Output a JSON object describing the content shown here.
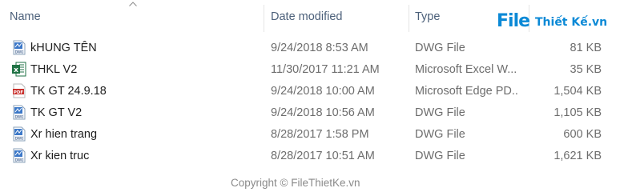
{
  "columns": {
    "name": "Name",
    "date": "Date modified",
    "type": "Type",
    "size": ""
  },
  "files": [
    {
      "name": "kHUNG TÊN",
      "date": "9/24/2018 8:53 AM",
      "type": "DWG File",
      "size": "81 KB",
      "icon": "dwg-file-icon"
    },
    {
      "name": "THKL V2",
      "date": "11/30/2017 11:21 AM",
      "type": "Microsoft Excel W...",
      "size": "35 KB",
      "icon": "excel-file-icon"
    },
    {
      "name": "TK GT 24.9.18",
      "date": "9/24/2018 10:00 AM",
      "type": "Microsoft Edge PD...",
      "size": "1,504 KB",
      "icon": "pdf-file-icon"
    },
    {
      "name": "TK GT V2",
      "date": "9/24/2018 10:56 AM",
      "type": "DWG File",
      "size": "1,105 KB",
      "icon": "dwg-file-icon"
    },
    {
      "name": "Xr hien trang",
      "date": "8/28/2017 1:58 PM",
      "type": "DWG File",
      "size": "600 KB",
      "icon": "dwg-file-icon"
    },
    {
      "name": "Xr kien truc",
      "date": "8/28/2017 10:51 AM",
      "type": "DWG File",
      "size": "1,621 KB",
      "icon": "dwg-file-icon"
    }
  ],
  "watermark": {
    "logo_file": "File",
    "logo_rest": "Thiết Kế.vn",
    "copyright": "Copyright © FileThietKe.vn"
  },
  "colors": {
    "accent": "#0b89d6",
    "header_text": "#4c607a",
    "secondary_text": "#6d6d6d"
  }
}
